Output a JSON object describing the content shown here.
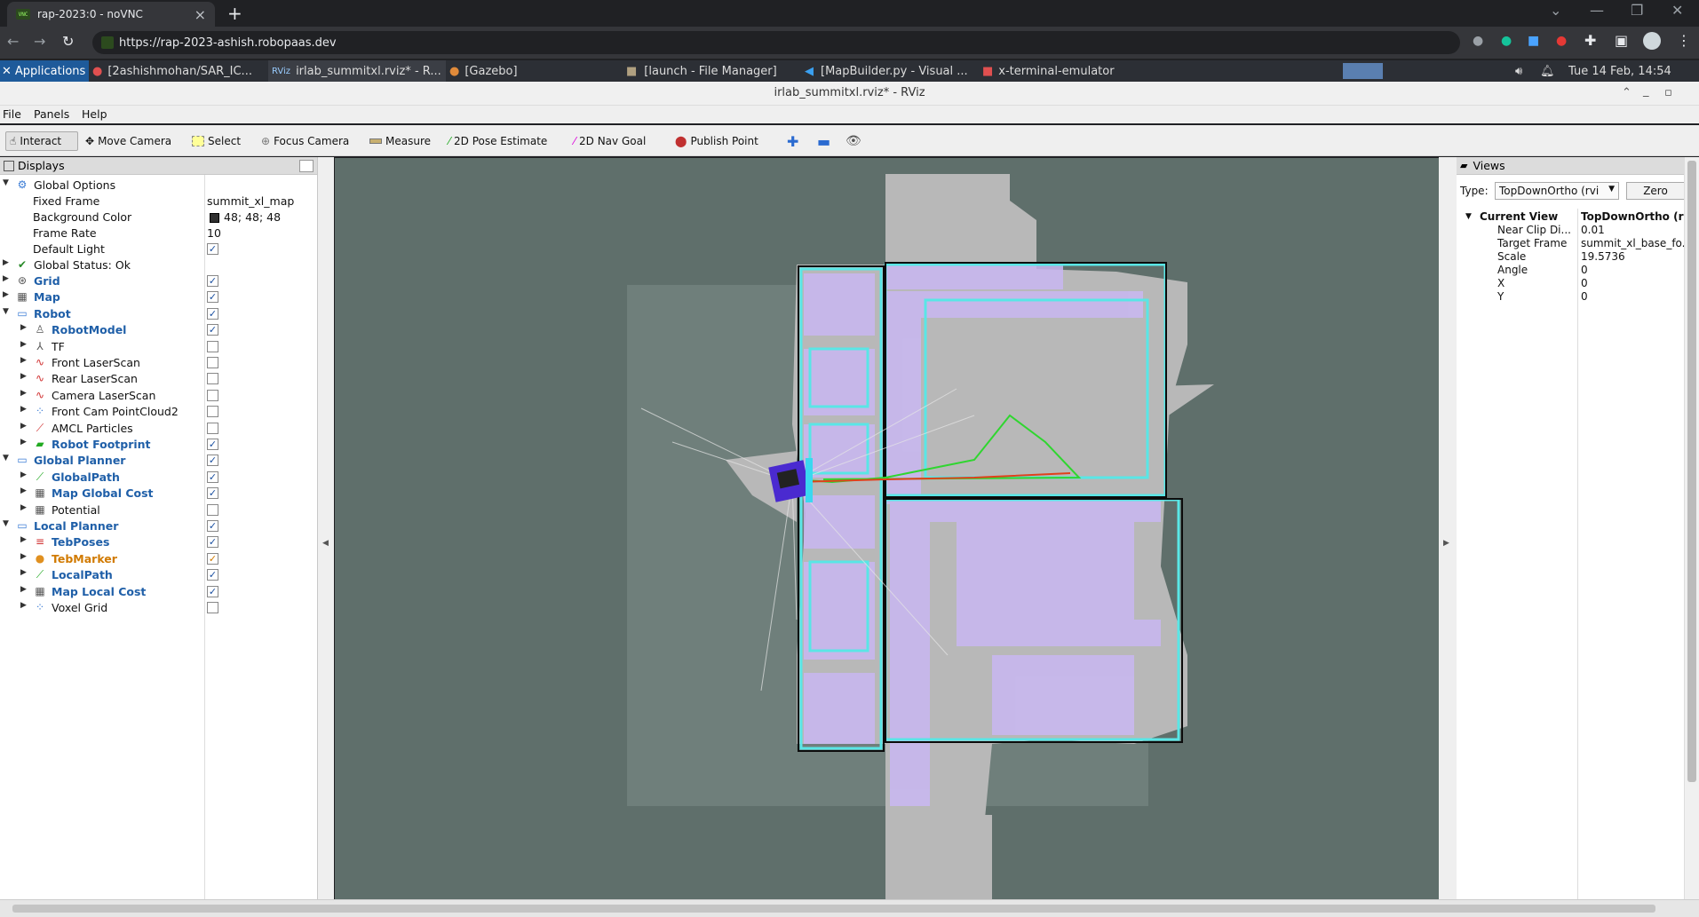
{
  "browser": {
    "tab_title": "rap-2023:0 - noVNC",
    "url": "https://rap-2023-ashish.robopaas.dev",
    "new_tab": "+",
    "close": "×"
  },
  "taskbar": {
    "applications": "Applications",
    "items": [
      "[2ashishmohan/SAR_IC...",
      "irlab_summitxl.rviz* - R...",
      "[Gazebo]",
      "[launch - File Manager]",
      "[MapBuilder.py - Visual ...",
      "x-terminal-emulator"
    ],
    "clock": "Tue 14 Feb, 14:54"
  },
  "window": {
    "title": "irlab_summitxl.rviz* - RViz"
  },
  "menu": [
    "File",
    "Panels",
    "Help"
  ],
  "toolbar": {
    "interact": "Interact",
    "move_camera": "Move Camera",
    "select": "Select",
    "focus_camera": "Focus Camera",
    "measure": "Measure",
    "pose_estimate": "2D Pose Estimate",
    "nav_goal": "2D Nav Goal",
    "publish_point": "Publish Point"
  },
  "displays": {
    "title": "Displays",
    "global_options": "Global Options",
    "fixed_frame_label": "Fixed Frame",
    "fixed_frame": "summit_xl_map",
    "background_color_label": "Background Color",
    "background_color": "48; 48; 48",
    "frame_rate_label": "Frame Rate",
    "frame_rate": "10",
    "default_light_label": "Default Light",
    "global_status": "Global Status: Ok",
    "items": [
      {
        "name": "Grid",
        "checked": true
      },
      {
        "name": "Map",
        "checked": true
      },
      {
        "name": "Robot",
        "checked": true
      },
      {
        "name": "RobotModel",
        "checked": true
      },
      {
        "name": "TF",
        "checked": false
      },
      {
        "name": "Front LaserScan",
        "checked": false
      },
      {
        "name": "Rear LaserScan",
        "checked": false
      },
      {
        "name": "Camera LaserScan",
        "checked": false
      },
      {
        "name": "Front Cam PointCloud2",
        "checked": false
      },
      {
        "name": "AMCL Particles",
        "checked": false
      },
      {
        "name": "Robot Footprint",
        "checked": true
      },
      {
        "name": "Global Planner",
        "checked": true
      },
      {
        "name": "GlobalPath",
        "checked": true
      },
      {
        "name": "Map Global Cost",
        "checked": true
      },
      {
        "name": "Potential",
        "checked": false
      },
      {
        "name": "Local Planner",
        "checked": true
      },
      {
        "name": "TebPoses",
        "checked": true
      },
      {
        "name": "TebMarker",
        "checked": true
      },
      {
        "name": "LocalPath",
        "checked": true
      },
      {
        "name": "Map Local Cost",
        "checked": true
      },
      {
        "name": "Voxel Grid",
        "checked": false
      }
    ]
  },
  "views": {
    "title": "Views",
    "type_label": "Type:",
    "type_value": "TopDownOrtho (rvi",
    "zero": "Zero",
    "current_view": "Current View",
    "current_view_value": "TopDownOrtho (r",
    "near_clip_label": "Near Clip Di...",
    "near_clip": "0.01",
    "target_frame_label": "Target Frame",
    "target_frame": "summit_xl_base_fo...",
    "scale_label": "Scale",
    "scale": "19.5736",
    "angle_label": "Angle",
    "angle": "0",
    "x_label": "X",
    "x": "0",
    "y_label": "Y",
    "y": "0"
  },
  "colors": {
    "viewport_bg": "#5f6f6b",
    "map_free": "#b8b8b8",
    "costmap": "#c9b7f2",
    "inflation": "#59e6e6",
    "path_green": "#2fd62f",
    "path_red": "#e0401a"
  }
}
